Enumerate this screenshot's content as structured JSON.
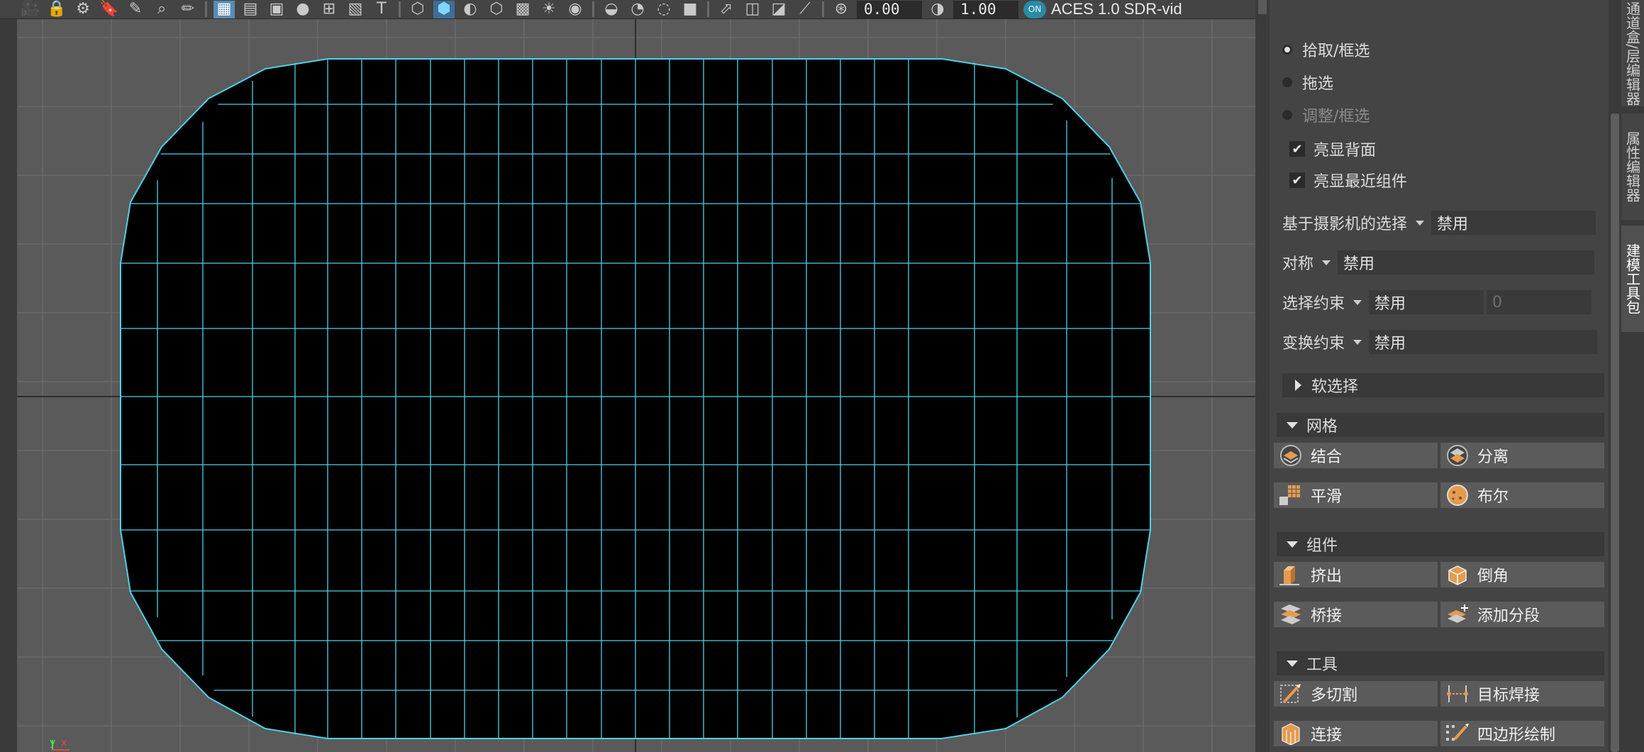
{
  "toolbar": {
    "exposure": "0.00",
    "gamma": "1.00",
    "color_mgmt_toggle": "ON",
    "view_transform": "ACES 1.0 SDR-vid"
  },
  "axis": {
    "y": "y",
    "x": "x"
  },
  "panel": {
    "selection_modes": [
      {
        "label": "拾取/框选",
        "selected": true,
        "enabled": true
      },
      {
        "label": "拖选",
        "selected": false,
        "enabled": true
      },
      {
        "label": "调整/框选",
        "selected": false,
        "enabled": false
      }
    ],
    "checkboxes": [
      {
        "label": "亮显背面",
        "checked": true
      },
      {
        "label": "亮显最近组件",
        "checked": true
      }
    ],
    "camera_select": {
      "label": "基于摄影机的选择",
      "value": "禁用"
    },
    "symmetry": {
      "label": "对称",
      "value": "禁用"
    },
    "select_constraint": {
      "label": "选择约束",
      "value": "禁用",
      "number": "0"
    },
    "transform_constraint": {
      "label": "变换约束",
      "value": "禁用"
    },
    "soft_select": "软选择",
    "mesh": {
      "title": "网格",
      "buttons": [
        "结合",
        "分离",
        "平滑",
        "布尔"
      ]
    },
    "components": {
      "title": "组件",
      "buttons": [
        "挤出",
        "倒角",
        "桥接",
        "添加分段"
      ]
    },
    "tools": {
      "title": "工具",
      "buttons": [
        "多切割",
        "目标焊接",
        "连接",
        "四边形绘制"
      ]
    }
  },
  "side_tabs": [
    "通道盒/层编辑器",
    "属性编辑器",
    "建模工具包"
  ],
  "colors": {
    "wire": "#4fd0e8",
    "accent": "#5a8bb3",
    "button": "#5b5b5b"
  }
}
